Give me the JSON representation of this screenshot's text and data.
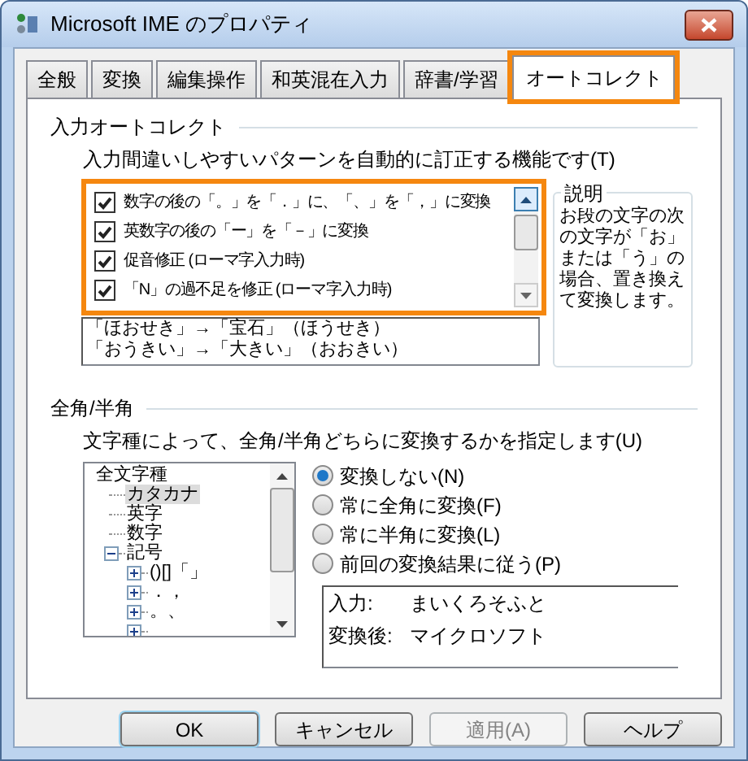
{
  "window": {
    "title": "Microsoft IME のプロパティ"
  },
  "tabs": [
    {
      "label": "全般",
      "selected": false,
      "highlighted": false
    },
    {
      "label": "変換",
      "selected": false,
      "highlighted": false
    },
    {
      "label": "編集操作",
      "selected": false,
      "highlighted": false
    },
    {
      "label": "和英混在入力",
      "selected": false,
      "highlighted": false
    },
    {
      "label": "辞書/学習",
      "selected": false,
      "highlighted": false
    },
    {
      "label": "オートコレクト",
      "selected": true,
      "highlighted": true
    }
  ],
  "autocorrect": {
    "heading": "入力オートコレクト",
    "description": "入力間違いしやすいパターンを自動的に訂正する機能です(T)",
    "list_highlighted": true,
    "items": [
      {
        "label": "数字の後の「。」を「．」に、「、」を「，」に変換",
        "checked": true
      },
      {
        "label": "英数字の後の「ー」を「－」に変換",
        "checked": true
      },
      {
        "label": "促音修正 (ローマ字入力時)",
        "checked": true
      },
      {
        "label": "「N」の過不足を修正 (ローマ字入力時)",
        "checked": true
      }
    ],
    "explanation": {
      "heading": "説明",
      "text": "お段の文字の次の文字が「お」または「う」の場合、置き換えて変換します。"
    },
    "example_lines": [
      "「ほおせき」→「宝石」（ほうせき）",
      "「おうきい」→「大きい」（おおきい）"
    ]
  },
  "width": {
    "heading": "全角/半角",
    "description": "文字種によって、全角/半角どちらに変換するかを指定します(U)",
    "tree": [
      {
        "label": "全文字種",
        "selected": false,
        "children": [
          {
            "label": "カタカナ",
            "selected": true
          },
          {
            "label": "英字",
            "selected": false
          },
          {
            "label": "数字",
            "selected": false
          },
          {
            "label": "記号",
            "selected": false,
            "expanded": true,
            "children": [
              {
                "label": "()[]「」",
                "selected": false,
                "expanded": false
              },
              {
                "label": "．，",
                "selected": false,
                "expanded": false
              },
              {
                "label": "。、",
                "selected": false,
                "expanded": false
              },
              {
                "expanded": false
              }
            ]
          }
        ]
      }
    ],
    "options": [
      {
        "label": "変換しない(N)",
        "selected": true
      },
      {
        "label": "常に全角に変換(F)",
        "selected": false
      },
      {
        "label": "常に半角に変換(L)",
        "selected": false
      },
      {
        "label": "前回の変換結果に従う(P)",
        "selected": false
      }
    ],
    "preview": [
      {
        "label": "入力:",
        "value": "まいくろそふと"
      },
      {
        "label": "変換後:",
        "value": "マイクロソフト"
      }
    ]
  },
  "buttons": [
    {
      "label": "OK",
      "default": true,
      "disabled": false
    },
    {
      "label": "キャンセル",
      "default": false,
      "disabled": false
    },
    {
      "label": "適用(A)",
      "default": false,
      "disabled": true
    },
    {
      "label": "ヘルプ",
      "default": false,
      "disabled": false
    }
  ]
}
